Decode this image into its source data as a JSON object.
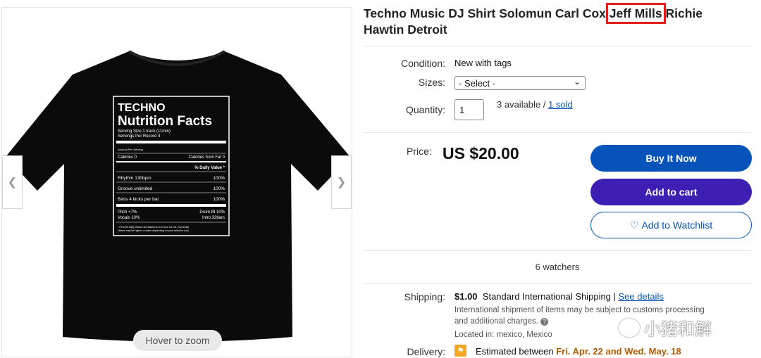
{
  "listing": {
    "title_part1": "Techno Music DJ Shirt Solomun Carl Cox ",
    "title_highlight": "Jeff Mills",
    "title_part2": " Richie Hawtin Detroit"
  },
  "gallery": {
    "zoom_hint": "Hover to zoom",
    "prev_icon": "chevron-left-icon",
    "next_icon": "chevron-right-icon",
    "shirt_print": {
      "heading1": "TECHNO",
      "heading2": "Nutrition Facts",
      "serving1": "Serving Size 1 track (11min)",
      "serving2": "Servings Per Record 4",
      "amount": "Amount Per Serving",
      "calories": "Calories 0",
      "calories_fat": "Calories from Fat 0",
      "daily_value": "% Daily Value *",
      "rows": [
        {
          "name": "Rhythm 130bpm",
          "pct": "100%"
        },
        {
          "name": "Groove unlimited",
          "pct": "100%"
        },
        {
          "name": "Bass 4 kicks per bar",
          "pct": "100%"
        }
      ],
      "pitch": "Pitch +7%",
      "drum": "Drum fill 10%",
      "vocals": "Vocals 10%",
      "intro": "Intro 32bars",
      "footnote1": "* Percent Daily Values are based on a 6 hour DJ set. Your Daily",
      "footnote2": "Values may be higher or lower depending on your need for soul."
    }
  },
  "details": {
    "condition_label": "Condition:",
    "condition_value": "New with tags",
    "sizes_label": "Sizes:",
    "sizes_selected": "- Select -",
    "quantity_label": "Quantity:",
    "quantity_value": "1",
    "available": "3 available / ",
    "sold": "1 sold"
  },
  "purchase": {
    "price_label": "Price:",
    "price": "US $20.00",
    "buy_now": "Buy It Now",
    "add_to_cart": "Add to cart",
    "watchlist": "Add to Watchlist",
    "watchers": "6 watchers"
  },
  "shipping": {
    "label": "Shipping:",
    "cost": "$1.00",
    "method": "Standard International Shipping | ",
    "see_details": "See details",
    "note1": "International shipment of items may be subject to customs processing",
    "note2": "and additional charges.",
    "location": "Located in: mexico, Mexico",
    "delivery_label": "Delivery:",
    "delivery_prefix": "Estimated between ",
    "delivery_dates": "Fri. Apr. 22 and Wed. May. 18"
  },
  "watermark": {
    "text": "小猪和解"
  },
  "colors": {
    "accent": "#0654ba",
    "cart": "#3d1fb3",
    "highlight": "#e01e1e",
    "delivery": "#b25a00"
  }
}
